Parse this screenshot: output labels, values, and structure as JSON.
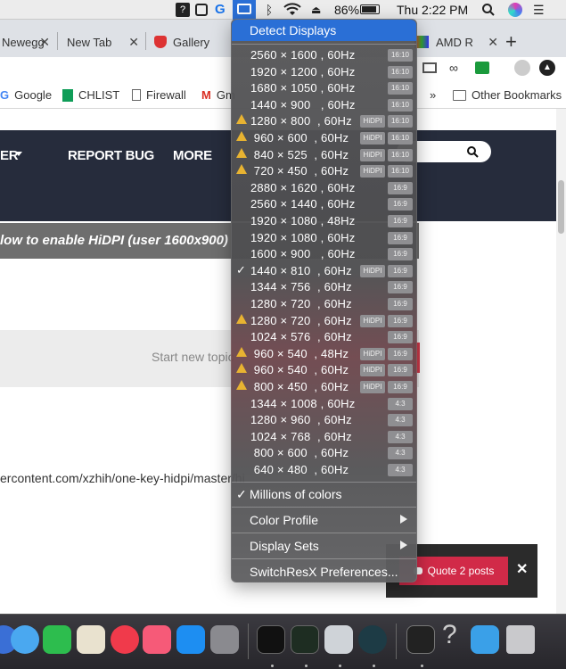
{
  "menubar": {
    "battery_percent": "86%",
    "clock": "Thu 2:22 PM"
  },
  "tabs": [
    {
      "label": "Newegg"
    },
    {
      "label": "New Tab"
    },
    {
      "label": "Gallery"
    },
    {
      "label": "AMD R"
    }
  ],
  "bookmarks": {
    "items": [
      "Google",
      "CHLIST",
      "Firewall",
      "Gm"
    ],
    "overflow": "»",
    "other": "Other Bookmarks"
  },
  "page": {
    "nav": [
      "ER",
      "REPORT BUG",
      "MORE"
    ],
    "topic_title": "low to enable HiDPI (user 1600x900)",
    "start_topic": "Start new topic",
    "url_fragment": "ercontent.com/xzhih/one-key-hidpi/master/hi",
    "quote_button": "Quote 2 posts",
    "quote_close": "✕"
  },
  "menu": {
    "header": "Detect Displays",
    "resolutions": [
      {
        "label": "2560 × 1600 , 60Hz",
        "warn": false,
        "check": false,
        "hidpi": "",
        "aspect": "16:10"
      },
      {
        "label": "1920 × 1200 , 60Hz",
        "warn": false,
        "check": false,
        "hidpi": "",
        "aspect": "16:10"
      },
      {
        "label": "1680 × 1050 , 60Hz",
        "warn": false,
        "check": false,
        "hidpi": "",
        "aspect": "16:10"
      },
      {
        "label": "1440 × 900   , 60Hz",
        "warn": false,
        "check": false,
        "hidpi": "",
        "aspect": "16:10"
      },
      {
        "label": "1280 × 800  , 60Hz",
        "warn": true,
        "check": false,
        "hidpi": "HiDPI",
        "aspect": "16:10"
      },
      {
        "label": " 960 × 600  , 60Hz",
        "warn": true,
        "check": false,
        "hidpi": "HiDPI",
        "aspect": "16:10"
      },
      {
        "label": " 840 × 525  , 60Hz",
        "warn": true,
        "check": false,
        "hidpi": "HiDPI",
        "aspect": "16:10"
      },
      {
        "label": " 720 × 450  , 60Hz",
        "warn": true,
        "check": false,
        "hidpi": "HiDPI",
        "aspect": "16:10"
      },
      {
        "label": "2880 × 1620 , 60Hz",
        "warn": false,
        "check": false,
        "hidpi": "",
        "aspect": "16:9"
      },
      {
        "label": "2560 × 1440 , 60Hz",
        "warn": false,
        "check": false,
        "hidpi": "",
        "aspect": "16:9"
      },
      {
        "label": "1920 × 1080 , 48Hz",
        "warn": false,
        "check": false,
        "hidpi": "",
        "aspect": "16:9"
      },
      {
        "label": "1920 × 1080 , 60Hz",
        "warn": false,
        "check": false,
        "hidpi": "",
        "aspect": "16:9"
      },
      {
        "label": "1600 × 900   , 60Hz",
        "warn": false,
        "check": false,
        "hidpi": "",
        "aspect": "16:9"
      },
      {
        "label": "1440 × 810  , 60Hz",
        "warn": false,
        "check": true,
        "hidpi": "HiDPI",
        "aspect": "16:9"
      },
      {
        "label": "1344 × 756  , 60Hz",
        "warn": false,
        "check": false,
        "hidpi": "",
        "aspect": "16:9"
      },
      {
        "label": "1280 × 720  , 60Hz",
        "warn": false,
        "check": false,
        "hidpi": "",
        "aspect": "16:9"
      },
      {
        "label": "1280 × 720  , 60Hz",
        "warn": true,
        "check": false,
        "hidpi": "HiDPI",
        "aspect": "16:9"
      },
      {
        "label": "1024 × 576  , 60Hz",
        "warn": false,
        "check": false,
        "hidpi": "",
        "aspect": "16:9"
      },
      {
        "label": " 960 × 540  , 48Hz",
        "warn": true,
        "check": false,
        "hidpi": "HiDPI",
        "aspect": "16:9"
      },
      {
        "label": " 960 × 540  , 60Hz",
        "warn": true,
        "check": false,
        "hidpi": "HiDPI",
        "aspect": "16:9"
      },
      {
        "label": " 800 × 450  , 60Hz",
        "warn": true,
        "check": false,
        "hidpi": "HiDPI",
        "aspect": "16:9"
      },
      {
        "label": "1344 × 1008 , 60Hz",
        "warn": false,
        "check": false,
        "hidpi": "",
        "aspect": "4:3"
      },
      {
        "label": "1280 × 960  , 60Hz",
        "warn": false,
        "check": false,
        "hidpi": "",
        "aspect": "4:3"
      },
      {
        "label": "1024 × 768  , 60Hz",
        "warn": false,
        "check": false,
        "hidpi": "",
        "aspect": "4:3"
      },
      {
        "label": " 800 × 600  , 60Hz",
        "warn": false,
        "check": false,
        "hidpi": "",
        "aspect": "4:3"
      },
      {
        "label": " 640 × 480  , 60Hz",
        "warn": false,
        "check": false,
        "hidpi": "",
        "aspect": "4:3"
      }
    ],
    "millions_of_colors": "Millions of colors",
    "color_profile": "Color Profile",
    "display_sets": "Display Sets",
    "preferences": "SwitchResX Preferences..."
  },
  "colors": {
    "menu_highlight": "#2a6fd6",
    "site_nav": "#262c3c",
    "quote_button": "#d12a48",
    "warning": "#e8b331"
  }
}
